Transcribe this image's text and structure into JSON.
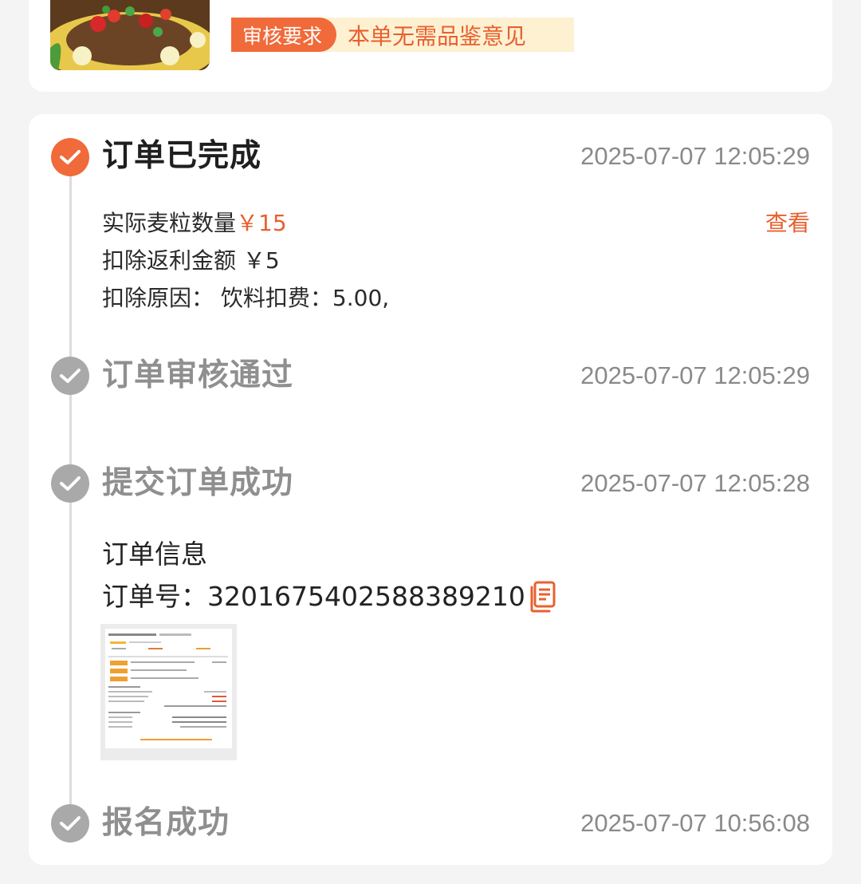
{
  "review": {
    "tag_label": "审核要求",
    "tag_value": "本单无需品鉴意见"
  },
  "steps": [
    {
      "title": "订单已完成",
      "time": "2025-07-07 12:05:29",
      "status": "active",
      "details": {
        "actual_label": "实际麦粒数量",
        "actual_value": "￥15",
        "view_label": "查看",
        "deduct_label": "扣除返利金额",
        "deduct_value": "￥5",
        "reason_label": "扣除原因：",
        "reason_value": "饮料扣费：5.00,"
      }
    },
    {
      "title": "订单审核通过",
      "time": "2025-07-07 12:05:29",
      "status": "done"
    },
    {
      "title": "提交订单成功",
      "time": "2025-07-07 12:05:28",
      "status": "done",
      "details": {
        "info_label": "订单信息",
        "order_no_label": "订单号：",
        "order_no": "320167540258838921​0"
      }
    },
    {
      "title": "报名成功",
      "time": "2025-07-07 10:56:08",
      "status": "done"
    }
  ],
  "colors": {
    "accent": "#f06a3a",
    "done_icon": "#a9a9a9",
    "badge_bg": "#fdf1d2"
  }
}
